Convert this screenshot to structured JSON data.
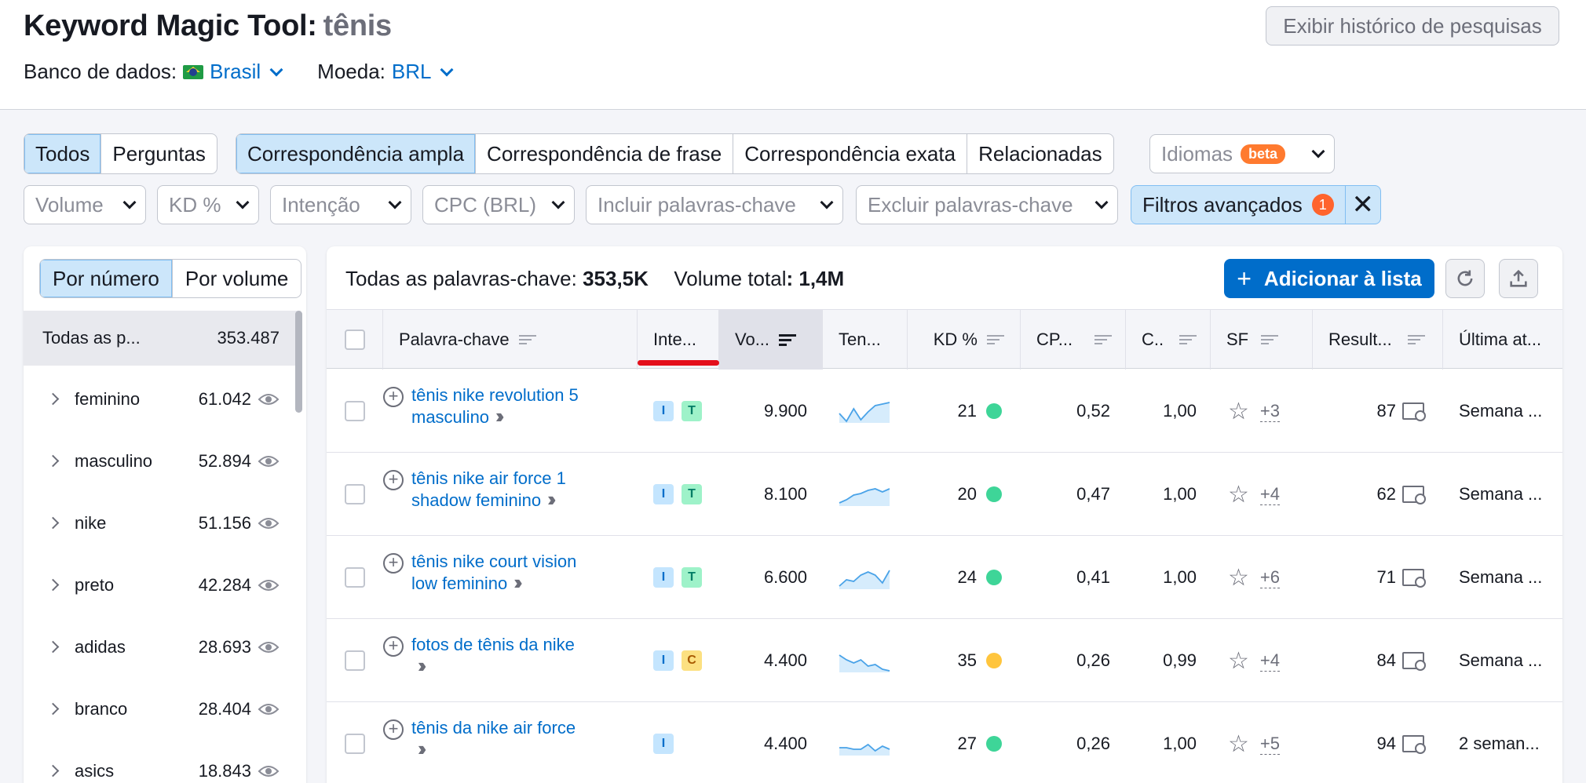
{
  "header": {
    "title": "Keyword Magic Tool:",
    "query": "tênis",
    "db_label": "Banco de dados:",
    "db_value": "Brasil",
    "currency_label": "Moeda:",
    "currency_value": "BRL",
    "history_button": "Exibir histórico de pesquisas"
  },
  "filters": {
    "type_tabs": [
      "Todos",
      "Perguntas"
    ],
    "match_tabs": [
      "Correspondência ampla",
      "Correspondência de frase",
      "Correspondência exata",
      "Relacionadas"
    ],
    "languages": "Idiomas",
    "beta": "beta",
    "volume": "Volume",
    "kd": "KD %",
    "intent": "Intenção",
    "cpc": "CPC (BRL)",
    "include": "Incluir palavras-chave",
    "exclude": "Excluir palavras-chave",
    "advanced": "Filtros avançados",
    "advanced_count": "1",
    "close": "✕"
  },
  "sidebar": {
    "by_number": "Por número",
    "by_volume": "Por volume",
    "all_label": "Todas as p...",
    "all_count": "353.487",
    "groups": [
      {
        "name": "feminino",
        "count": "61.042"
      },
      {
        "name": "masculino",
        "count": "52.894"
      },
      {
        "name": "nike",
        "count": "51.156"
      },
      {
        "name": "preto",
        "count": "42.284"
      },
      {
        "name": "adidas",
        "count": "28.693"
      },
      {
        "name": "branco",
        "count": "28.404"
      },
      {
        "name": "asics",
        "count": "18.843"
      }
    ]
  },
  "summary": {
    "all_label": "Todas as palavras-chave:",
    "all_value": "353,5K",
    "vol_label": "Volume total",
    "vol_value": "1,4M",
    "add_button": "Adicionar à lista"
  },
  "columns": [
    "Palavra-chave",
    "Inte...",
    "Vo...",
    "Ten...",
    "KD %",
    "CP...",
    "C..",
    "SF",
    "Result...",
    "Última at..."
  ],
  "rows": [
    {
      "kw1": "tênis nike revolution 5",
      "kw2": "masculino",
      "intents": [
        "I",
        "T"
      ],
      "volume": "9.900",
      "kd": "21",
      "kd_color": "#3ed598",
      "cpc": "0,52",
      "com": "1,00",
      "sf": "+3",
      "results": "87",
      "updated": "Semana ...",
      "trend": [
        12,
        2,
        18,
        4,
        14,
        22,
        24,
        26
      ]
    },
    {
      "kw1": "tênis nike air force 1",
      "kw2": "shadow feminino",
      "intents": [
        "I",
        "T"
      ],
      "volume": "8.100",
      "kd": "20",
      "kd_color": "#3ed598",
      "cpc": "0,47",
      "com": "1,00",
      "sf": "+4",
      "results": "62",
      "updated": "Semana ...",
      "trend": [
        4,
        8,
        14,
        16,
        20,
        22,
        18,
        22
      ]
    },
    {
      "kw1": "tênis nike court vision",
      "kw2": "low feminino",
      "intents": [
        "I",
        "T"
      ],
      "volume": "6.600",
      "kd": "24",
      "kd_color": "#3ed598",
      "cpc": "0,41",
      "com": "1,00",
      "sf": "+6",
      "results": "71",
      "updated": "Semana ...",
      "trend": [
        4,
        12,
        10,
        18,
        22,
        18,
        8,
        24
      ]
    },
    {
      "kw1": "fotos de tênis da nike",
      "kw2": "",
      "intents": [
        "I",
        "C"
      ],
      "volume": "4.400",
      "kd": "35",
      "kd_color": "#ffc53d",
      "cpc": "0,26",
      "com": "0,99",
      "sf": "+4",
      "results": "84",
      "updated": "Semana ...",
      "trend": [
        22,
        16,
        12,
        16,
        8,
        10,
        4,
        2
      ]
    },
    {
      "kw1": "tênis da nike air force",
      "kw2": "",
      "intents": [
        "I"
      ],
      "volume": "4.400",
      "kd": "27",
      "kd_color": "#3ed598",
      "cpc": "0,26",
      "com": "1,00",
      "sf": "+5",
      "results": "94",
      "updated": "2 seman...",
      "trend": [
        10,
        10,
        8,
        8,
        14,
        6,
        12,
        8
      ]
    }
  ]
}
